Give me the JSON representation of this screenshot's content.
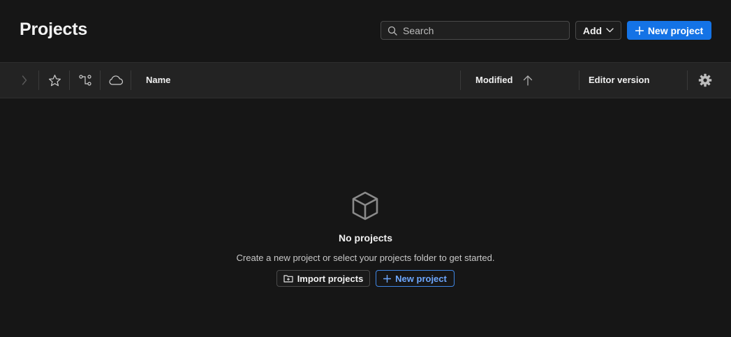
{
  "header": {
    "title": "Projects",
    "search_placeholder": "Search",
    "add_label": "Add",
    "new_project_label": "New project"
  },
  "table": {
    "columns": {
      "name": "Name",
      "modified": "Modified",
      "editor_version": "Editor version"
    }
  },
  "empty_state": {
    "title": "No projects",
    "description": "Create a new project or select your projects folder to get started.",
    "import_label": "Import projects",
    "new_project_label": "New project"
  },
  "colors": {
    "background": "#161616",
    "header_row": "#232323",
    "accent": "#1473e6",
    "accent_text": "#6ea8ff"
  },
  "icons": [
    "search-icon",
    "chevron-down-icon",
    "plus-icon",
    "chevron-right-icon",
    "star-icon",
    "branch-icon",
    "cloud-icon",
    "sort-arrow-up-icon",
    "gear-icon",
    "cube-icon",
    "folder-import-icon"
  ]
}
